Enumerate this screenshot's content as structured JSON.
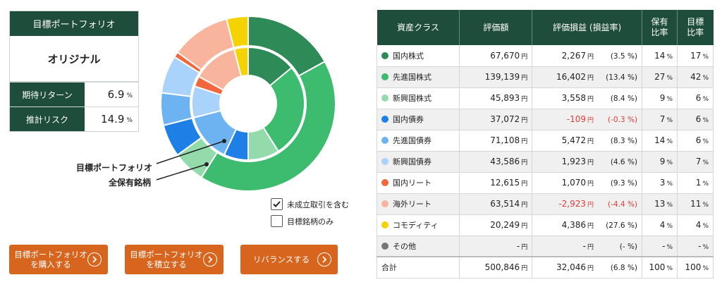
{
  "summary": {
    "header": "目標ポートフォリオ",
    "name": "オリジナル",
    "expected_return_label": "期待リターン",
    "expected_return_value": "6.9",
    "risk_label": "推計リスク",
    "risk_value": "14.9",
    "unit": "%"
  },
  "donut": {
    "annotation_target": "目標ポートフォリオ",
    "annotation_holdings": "全保有銘柄"
  },
  "options": {
    "include_unfilled": "未成立取引を含む",
    "include_unfilled_checked": true,
    "target_only": "目標銘柄のみ",
    "target_only_checked": false
  },
  "buttons": {
    "buy_target": "目標ポートフォリオ\nを購入する",
    "accumulate_target": "目標ポートフォリオ\nを積立する",
    "rebalance": "リバランスする"
  },
  "table": {
    "headers": {
      "asset_class": "資産クラス",
      "value": "評価額",
      "pl": "評価損益 (損益率)",
      "holding_ratio": "保有\n比率",
      "target_ratio": "目標\n比率"
    },
    "yen": "円",
    "pct": "%",
    "rows": [
      {
        "name": "国内株式",
        "color": "#2e8b57",
        "value": "67,670",
        "pl": "2,267",
        "rate": "(3.5 %)",
        "negative": false,
        "hold": "14",
        "target": "17"
      },
      {
        "name": "先進国株式",
        "color": "#3dbb6e",
        "value": "139,139",
        "pl": "16,402",
        "rate": "(13.4 %)",
        "negative": false,
        "hold": "27",
        "target": "42"
      },
      {
        "name": "新興国株式",
        "color": "#93dbab",
        "value": "45,893",
        "pl": "3,558",
        "rate": "(8.4 %)",
        "negative": false,
        "hold": "9",
        "target": "6"
      },
      {
        "name": "国内債券",
        "color": "#1e7fe6",
        "value": "37,072",
        "pl": "-109",
        "rate": "(-0.3 %)",
        "negative": true,
        "hold": "7",
        "target": "6"
      },
      {
        "name": "先進国債券",
        "color": "#6db3f2",
        "value": "71,108",
        "pl": "5,472",
        "rate": "(8.3 %)",
        "negative": false,
        "hold": "14",
        "target": "6"
      },
      {
        "name": "新興国債券",
        "color": "#a9d3fa",
        "value": "43,586",
        "pl": "1,923",
        "rate": "(4.6 %)",
        "negative": false,
        "hold": "9",
        "target": "7"
      },
      {
        "name": "国内リート",
        "color": "#f2683c",
        "value": "12,615",
        "pl": "1,070",
        "rate": "(9.3 %)",
        "negative": false,
        "hold": "3",
        "target": "1"
      },
      {
        "name": "海外リート",
        "color": "#f8b49c",
        "value": "63,514",
        "pl": "-2,923",
        "rate": "(-4.4 %)",
        "negative": true,
        "hold": "13",
        "target": "11"
      },
      {
        "name": "コモディティ",
        "color": "#f4d300",
        "value": "20,249",
        "pl": "4,386",
        "rate": "(27.6 %)",
        "negative": false,
        "hold": "4",
        "target": "4"
      },
      {
        "name": "その他",
        "color": "#777777",
        "value": "-",
        "pl": "-",
        "rate": "(- %)",
        "negative": false,
        "hold": "-",
        "target": "-"
      }
    ],
    "total": {
      "name": "合計",
      "value": "500,846",
      "pl": "32,046",
      "rate": "(6.8 %)",
      "hold": "100",
      "target": "100"
    }
  }
}
